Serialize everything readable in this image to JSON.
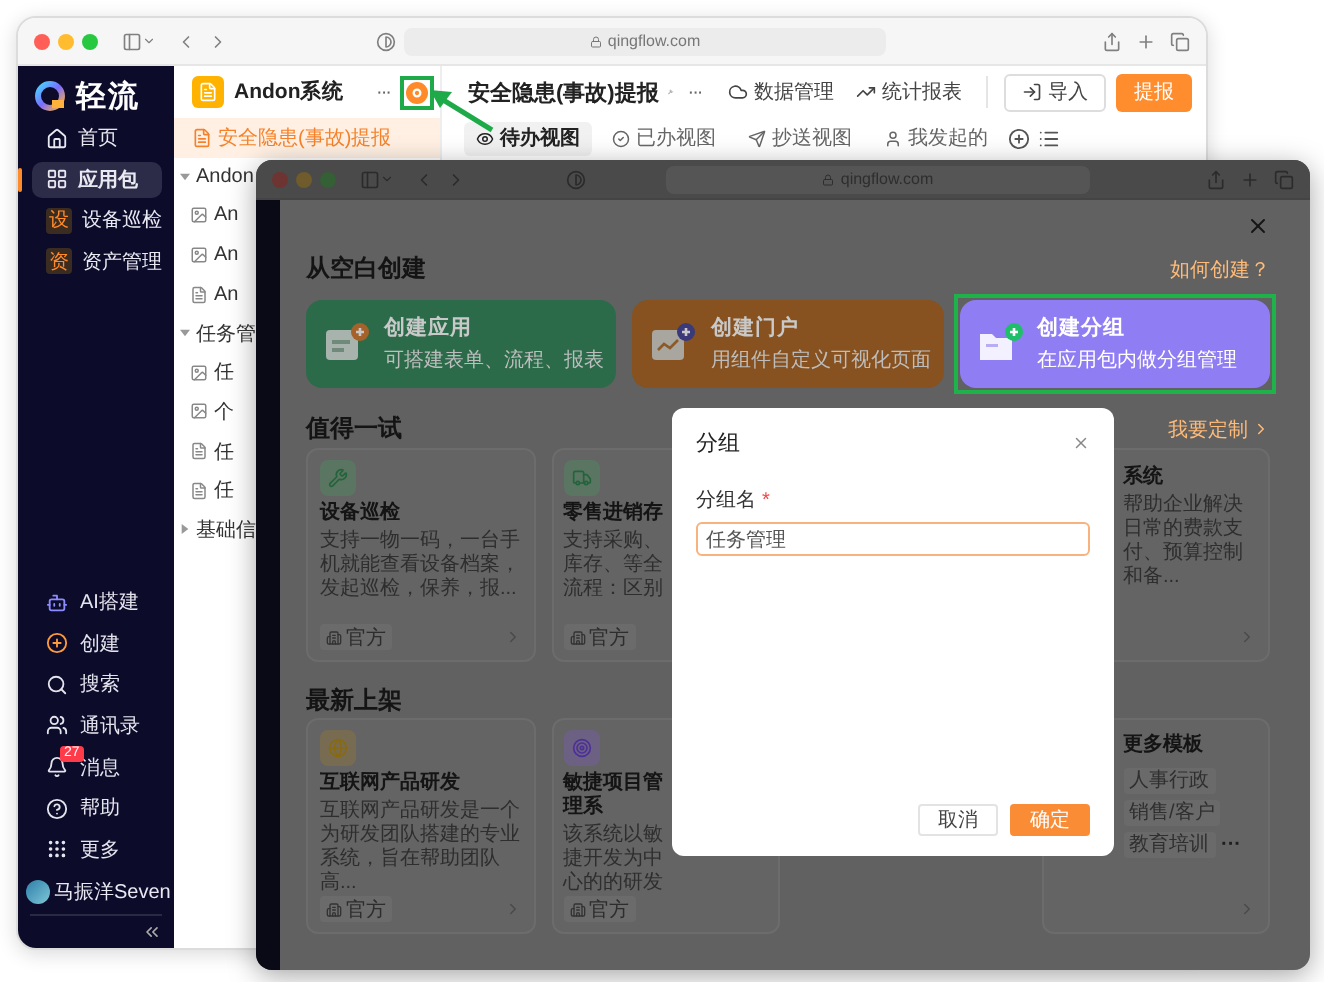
{
  "back_window": {
    "url": "qingflow.com",
    "sidebar": {
      "logo": "轻流",
      "items": [
        {
          "label": "首页",
          "kind": "home",
          "selected": false
        },
        {
          "label": "应用包",
          "kind": "apps",
          "selected": true
        },
        {
          "label": "设备巡检",
          "kind": "badge",
          "badge": "设",
          "selected": false
        },
        {
          "label": "资产管理",
          "kind": "badge",
          "badge": "资",
          "selected": false
        }
      ],
      "tools": [
        {
          "label": "AI搭建",
          "kind": "ai"
        },
        {
          "label": "创建",
          "kind": "create"
        },
        {
          "label": "搜索",
          "kind": "search"
        },
        {
          "label": "通讯录",
          "kind": "contacts"
        },
        {
          "label": "消息",
          "kind": "messages",
          "count": "27"
        },
        {
          "label": "帮助",
          "kind": "help"
        },
        {
          "label": "更多",
          "kind": "more"
        }
      ],
      "user": "马振洋Seven"
    },
    "app_panel": {
      "title": "Andon系统",
      "menu": "···",
      "add_button": {
        "highlighted": true
      },
      "tree": [
        {
          "label": "安全隐患(事故)提报",
          "kind": "form",
          "selected": true
        },
        {
          "label": "Andon",
          "kind": "group",
          "expanded": true,
          "selected": false,
          "children": [
            {
              "label": "An",
              "kind": "dashboard",
              "selected": false
            },
            {
              "label": "An",
              "kind": "dashboard",
              "selected": false
            },
            {
              "label": "An",
              "kind": "form",
              "selected": false
            }
          ]
        },
        {
          "label": "任务管",
          "kind": "group",
          "expanded": true,
          "selected": false,
          "children": [
            {
              "label": "任",
              "kind": "dashboard",
              "selected": false
            },
            {
              "label": "个",
              "kind": "dashboard",
              "selected": false
            },
            {
              "label": "任",
              "kind": "form",
              "selected": false
            },
            {
              "label": "任",
              "kind": "form",
              "selected": false
            }
          ]
        },
        {
          "label": "基础信",
          "kind": "group",
          "expanded": false,
          "selected": false
        }
      ]
    },
    "main": {
      "title": "安全隐患(事故)提报",
      "menu": "···",
      "actions": [
        {
          "label": "数据管理",
          "kind": "data"
        },
        {
          "label": "统计报表",
          "kind": "chart"
        }
      ],
      "import_button": "导入",
      "submit_button": "提报",
      "tabs": [
        {
          "label": "待办视图",
          "kind": "todo",
          "selected": true
        },
        {
          "label": "已办视图",
          "kind": "done",
          "selected": false
        },
        {
          "label": "抄送视图",
          "kind": "cc",
          "selected": false
        },
        {
          "label": "我发起的",
          "kind": "mine",
          "selected": false
        }
      ]
    }
  },
  "front_window": {
    "url": "qingflow.com",
    "blank": {
      "title": "从空白创建",
      "link": "如何创建？",
      "cards": [
        {
          "title": "创建应用",
          "subtitle": "可搭建表单、流程、报表",
          "kind": "app",
          "color": "#2b6b4a",
          "highlighted": false
        },
        {
          "title": "创建门户",
          "subtitle": "用组件自定义可视化页面",
          "kind": "portal",
          "color": "#87521f",
          "highlighted": false
        },
        {
          "title": "创建分组",
          "subtitle": "在应用包内做分组管理",
          "kind": "group",
          "color": "#8f7df4",
          "highlighted": true
        }
      ]
    },
    "try": {
      "title": "值得一试",
      "link": "我要定制",
      "cards": [
        {
          "kind": "template",
          "title": "设备巡检",
          "description": "支持一物一码，一台手机就能查看设备档案，发起巡检，保养，报...",
          "tag": "官方"
        },
        {
          "kind": "template",
          "title": "零售进销存",
          "description": "支持采购、库存、等全流程：区别",
          "tag": "官方"
        },
        {
          "kind": "template",
          "title": "系统",
          "description": "帮助企业解决日常的费款支付、预算控制和备..."
        }
      ]
    },
    "latest": {
      "title": "最新上架",
      "cards": [
        {
          "kind": "template",
          "title": "互联网产品研发",
          "description": "互联网产品研发是一个为研发团队搭建的专业系统，旨在帮助团队高...",
          "tag": "官方"
        },
        {
          "kind": "template",
          "title": "敏捷项目管理系",
          "description": "该系统以敏捷开发为中心的的研发",
          "tag": "官方"
        },
        {
          "kind": "more",
          "title": "更多模板",
          "tags": [
            "人事行政",
            "销售/客户",
            "教育培训"
          ],
          "more": "···"
        }
      ]
    },
    "dialog": {
      "title": "分组",
      "field": {
        "label": "分组名",
        "required_mark": "*",
        "value": "任务管理",
        "focused": true
      },
      "buttons": [
        {
          "label": "取消",
          "kind": "secondary"
        },
        {
          "label": "确定",
          "kind": "primary"
        }
      ]
    }
  }
}
